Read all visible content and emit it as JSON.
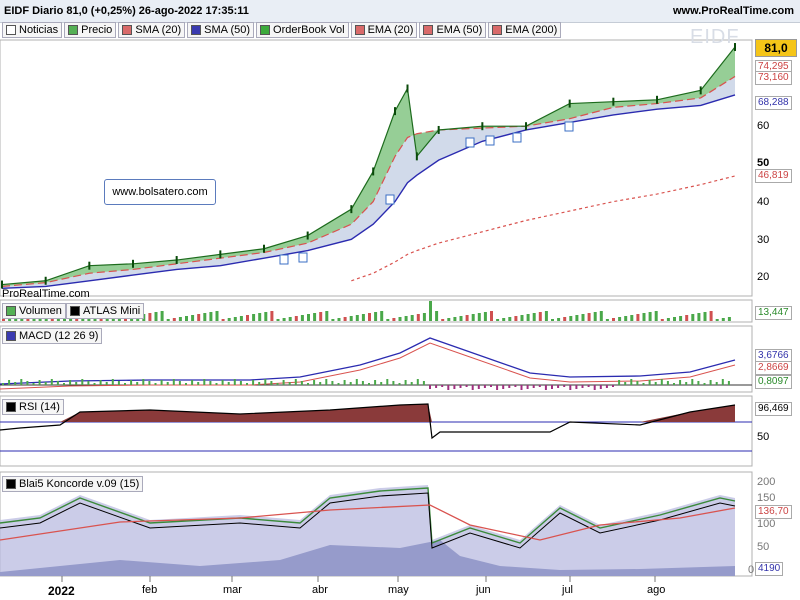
{
  "header": {
    "title": "EIDF Diario 81,0 (+0,25%) 26-ago-2022 17:35:11",
    "site": "www.ProRealTime.com"
  },
  "legend": [
    {
      "label": "Noticias",
      "color": "#ffffff"
    },
    {
      "label": "Precio",
      "color": "#55b055"
    },
    {
      "label": "SMA (20)",
      "color": "#d96a6a"
    },
    {
      "label": "SMA (50)",
      "color": "#3a3ab0"
    },
    {
      "label": "OrderBook Vol",
      "color": "#3caa3c"
    },
    {
      "label": "EMA (20)",
      "color": "#d96a6a"
    },
    {
      "label": "EMA (50)",
      "color": "#d96a6a"
    },
    {
      "label": "EMA (200)",
      "color": "#d96a6a"
    }
  ],
  "ticker_watermark": "EIDF",
  "annotation": "www.bolsatero.com",
  "source_label": "ProRealTime.com",
  "price_axis": {
    "last_price": "81,0",
    "ticks": [
      "60",
      "50",
      "40",
      "30",
      "20"
    ],
    "boxes": [
      {
        "text": "74,295",
        "color": "#c44"
      },
      {
        "text": "73,160",
        "color": "#c44"
      },
      {
        "text": "68,288",
        "color": "#33a"
      },
      {
        "text": "46,819",
        "color": "#c44"
      }
    ]
  },
  "panels": {
    "volume": {
      "labels": [
        "Volumen",
        "ATLAS Mini"
      ],
      "value": "13,447"
    },
    "macd": {
      "label": "MACD (12 26 9)",
      "values": [
        "3,6766",
        "2,8669",
        "0,8097"
      ]
    },
    "rsi": {
      "label": "RSI (14)",
      "value": "96,469",
      "tick": "50"
    },
    "koncorde": {
      "label": "Blai5 Koncorde v.09 (15)",
      "values": [
        "136,70",
        "4190"
      ],
      "ticks": [
        "200",
        "150",
        "100",
        "50",
        "0"
      ]
    }
  },
  "x_axis": {
    "months": [
      "2022",
      "feb",
      "mar",
      "abr",
      "may",
      "jun",
      "jul",
      "ago"
    ]
  },
  "chart_data": {
    "type": "line",
    "title": "EIDF Diario",
    "x": [
      "2022-01-03",
      "2022-01-17",
      "2022-01-31",
      "2022-02-14",
      "2022-02-28",
      "2022-03-14",
      "2022-03-28",
      "2022-04-11",
      "2022-04-25",
      "2022-05-02",
      "2022-05-09",
      "2022-05-13",
      "2022-05-16",
      "2022-05-23",
      "2022-06-06",
      "2022-06-20",
      "2022-07-04",
      "2022-07-18",
      "2022-08-01",
      "2022-08-15",
      "2022-08-26"
    ],
    "ylim": [
      15,
      85
    ],
    "series": [
      {
        "name": "Precio",
        "values": [
          18,
          19,
          23,
          23.5,
          24.5,
          26,
          27.5,
          31,
          38,
          48,
          64,
          70,
          52,
          59,
          60,
          60,
          66,
          66.5,
          67,
          69.5,
          81
        ]
      },
      {
        "name": "SMA (20)",
        "values": [
          17.5,
          18.5,
          21,
          22,
          23.5,
          25,
          26.5,
          29,
          34,
          40,
          52,
          57,
          58,
          59,
          59.5,
          60,
          62,
          65,
          66,
          67.5,
          73.2
        ]
      },
      {
        "name": "SMA (50)",
        "values": [
          17,
          17.5,
          19,
          20.5,
          22,
          23,
          25,
          27,
          30,
          34,
          40,
          45,
          47,
          51,
          56,
          59,
          61,
          63,
          64.5,
          65.5,
          68.3
        ]
      },
      {
        "name": "EMA (200)",
        "values": [
          null,
          null,
          null,
          null,
          null,
          null,
          null,
          null,
          19,
          21,
          24,
          26,
          27,
          29,
          32,
          35,
          37.5,
          40,
          42,
          44.5,
          46.8
        ]
      }
    ]
  }
}
